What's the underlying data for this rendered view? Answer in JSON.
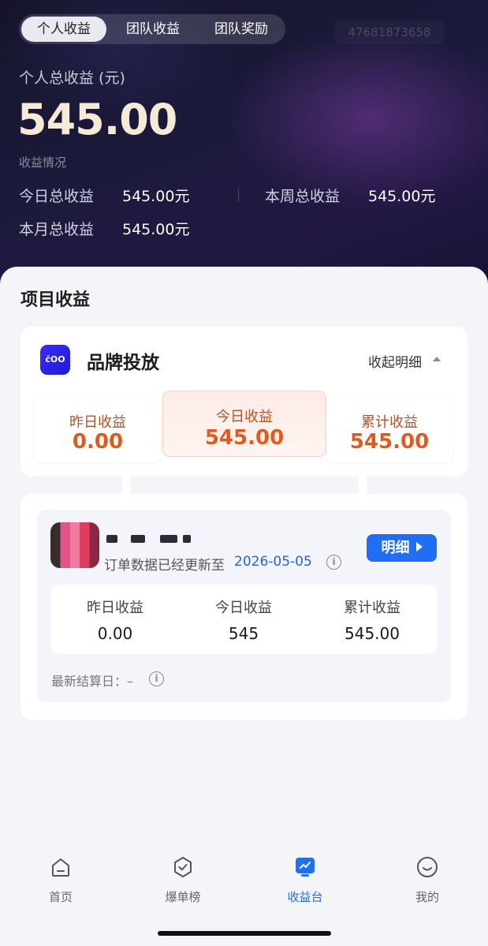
{
  "header": {
    "tabs": [
      {
        "label": "个人收益",
        "active": true
      },
      {
        "label": "团队收益",
        "active": false
      },
      {
        "label": "团队奖励",
        "active": false
      }
    ],
    "user_id": "47681873658",
    "total_label": "个人总收益 (元)",
    "total_value": "545.00",
    "sub_label": "收益情况",
    "stats": {
      "today_label": "今日总收益",
      "today_value": "545.00元",
      "week_label": "本周总收益",
      "week_value": "545.00元",
      "month_label": "本月总收益",
      "month_value": "545.00元"
    }
  },
  "project": {
    "section_title": "项目收益",
    "brand_icon_text": "ĉOO",
    "brand_name": "品牌投放",
    "collapse_label": "收起明细",
    "summary": {
      "yesterday_label": "昨日收益",
      "yesterday_value": "0.00",
      "today_label": "今日收益",
      "today_value": "545.00",
      "total_label": "累计收益",
      "total_value": "545.00"
    },
    "item": {
      "update_text": "订单数据已经更新至",
      "update_date": "2026-05-05",
      "detail_button": "明细",
      "yesterday_label": "昨日收益",
      "yesterday_value": "0.00",
      "today_label": "今日收益",
      "today_value": "545",
      "total_label": "累计收益",
      "total_value": "545.00",
      "settle_label": "最新结算日：",
      "settle_value": "–"
    }
  },
  "tabbar": {
    "items": [
      {
        "label": "首页",
        "icon": "home-icon",
        "active": false
      },
      {
        "label": "爆单榜",
        "icon": "badge-check-icon",
        "active": false
      },
      {
        "label": "收益台",
        "icon": "earnings-icon",
        "active": true
      },
      {
        "label": "我的",
        "icon": "smile-icon",
        "active": false
      }
    ]
  },
  "colors": {
    "accent": "#1f6ef5",
    "earnings_orange": "#e05a1c",
    "hero_bg": "#1c1a3c"
  }
}
